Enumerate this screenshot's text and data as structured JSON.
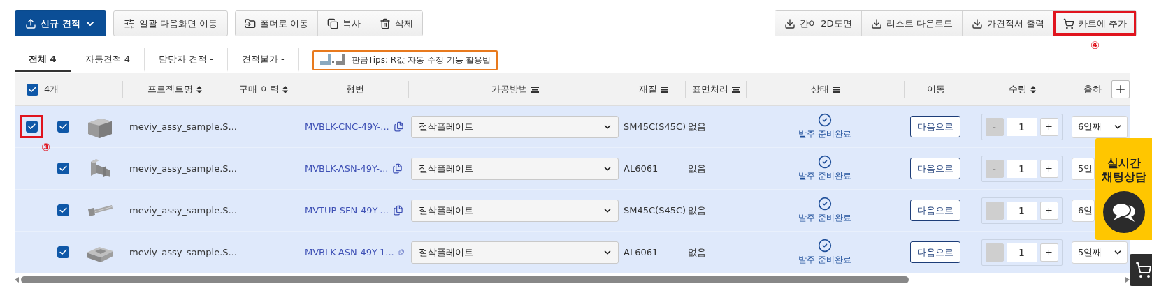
{
  "toolbar": {
    "left": [
      {
        "label": "신규 견적",
        "kind": "primary"
      },
      {
        "label": "일괄 다음화면 이동",
        "kind": "plain"
      }
    ],
    "group": [
      {
        "label": "폴더로 이동"
      },
      {
        "label": "복사"
      },
      {
        "label": "삭제"
      }
    ],
    "right": [
      {
        "label": "간이 2D도면",
        "highlighted": false
      },
      {
        "label": "리스트 다운로드",
        "highlighted": false
      },
      {
        "label": "가견적서 출력",
        "highlighted": false
      },
      {
        "label": "카트에 추가",
        "highlighted": true,
        "annotation": "④"
      }
    ]
  },
  "tabs": [
    {
      "label": "전체 4",
      "selected": true
    },
    {
      "label": "자동견적 4",
      "selected": false
    },
    {
      "label": "담당자 견적 -",
      "selected": false
    },
    {
      "label": "견적불가 -",
      "selected": false
    }
  ],
  "tip_banner": {
    "text": "판금Tips: R값 자동 수정 기능 활용법"
  },
  "table": {
    "select_all": {
      "label": "4개",
      "checked": true
    },
    "columns": [
      {
        "label": "프로젝트명",
        "kind": "sortable"
      },
      {
        "label": "구매 이력",
        "kind": "sortable"
      },
      {
        "label": "형번",
        "kind": "plain"
      },
      {
        "label": "가공방법",
        "kind": "filterable"
      },
      {
        "label": "재질",
        "kind": "filterable"
      },
      {
        "label": "표면처리",
        "kind": "filterable"
      },
      {
        "label": "상태",
        "kind": "filterable"
      },
      {
        "label": "이동",
        "kind": "plain"
      },
      {
        "label": "수량",
        "kind": "sortable"
      },
      {
        "label": "출하",
        "kind": "addable"
      }
    ],
    "rows": [
      {
        "outer_checkbox": {
          "checked": true,
          "highlighted": true,
          "annotation": "③"
        },
        "checked": true,
        "name": "meviy_assy_sample.S...",
        "part_number": "MVBLK-CNC-49Y-...",
        "method": "절삭플레이트",
        "material": "SM45C(S45C)",
        "surface": "없음",
        "status": "발주 준비완료",
        "move": "다음으로",
        "minus": "-",
        "minus_disabled": true,
        "quantity": "1",
        "plus": "+",
        "ship_day": "6일째"
      },
      {
        "checked": true,
        "name": "meviy_assy_sample.S...",
        "part_number": "MVBLK-ASN-49Y-...",
        "method": "절삭플레이트",
        "material": "AL6061",
        "surface": "없음",
        "status": "발주 준비완료",
        "move": "다음으로",
        "minus": "-",
        "minus_disabled": true,
        "quantity": "1",
        "plus": "+",
        "ship_day": "5일"
      },
      {
        "checked": true,
        "name": "meviy_assy_sample.S...",
        "part_number": "MVTUP-SFN-49Y-...",
        "method": "절삭플레이트",
        "material": "SM45C(S45C)",
        "surface": "없음",
        "status": "발주 준비완료",
        "move": "다음으로",
        "minus": "-",
        "minus_disabled": true,
        "quantity": "1",
        "plus": "+",
        "ship_day": "6일"
      },
      {
        "checked": true,
        "name": "meviy_assy_sample.S...",
        "part_number": "MVBLK-ASN-49Y-1...",
        "method": "절삭플레이트",
        "material": "AL6061",
        "surface": "없음",
        "status": "발주 준비완료",
        "move": "다음으로",
        "minus": "-",
        "minus_disabled": true,
        "quantity": "1",
        "plus": "+",
        "ship_day": "5일째"
      }
    ]
  },
  "chat_widget": {
    "lines": [
      "실시간",
      "채팅상담"
    ]
  }
}
